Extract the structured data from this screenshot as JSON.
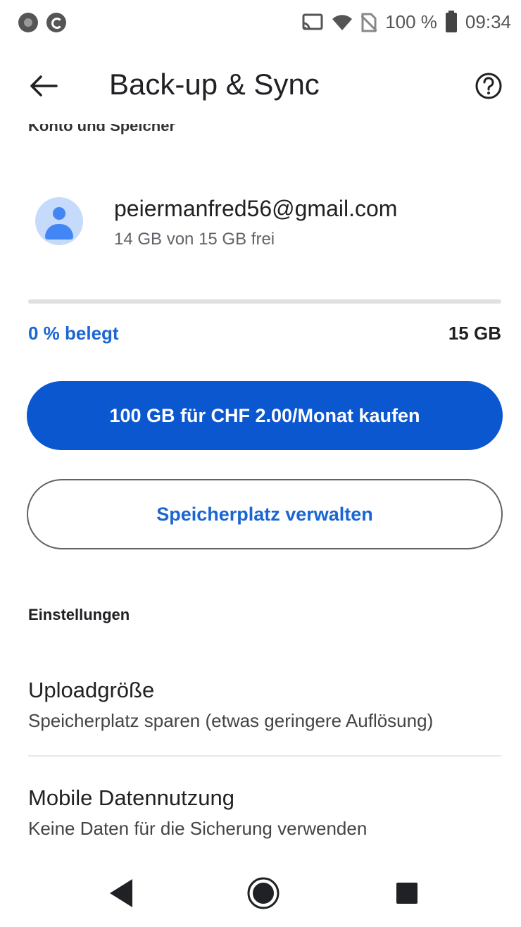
{
  "status_bar": {
    "battery": "100 %",
    "time": "09:34"
  },
  "app_bar": {
    "title": "Back-up & Sync"
  },
  "section_peek": "Konto und Speicher",
  "account": {
    "email": "peiermanfred56@gmail.com",
    "storage_free": "14 GB von 15 GB frei"
  },
  "storage": {
    "used_fraction": 0.0,
    "used_label": "0 % belegt",
    "total_label": "15 GB"
  },
  "buttons": {
    "buy": "100 GB für CHF 2.00/Monat kaufen",
    "manage": "Speicherplatz verwalten"
  },
  "settings": {
    "header": "Einstellungen",
    "items": [
      {
        "title": "Uploadgröße",
        "subtitle": "Speicherplatz sparen (etwas geringere Auflösung)"
      },
      {
        "title": "Mobile Datennutzung",
        "subtitle": "Keine Daten für die Sicherung verwenden"
      }
    ]
  },
  "colors": {
    "accent": "#0b57d0",
    "link": "#1a66d2"
  },
  "icons": [
    "back-arrow-icon",
    "help-icon",
    "avatar-icon",
    "cast-icon",
    "wifi-icon",
    "no-sim-icon",
    "battery-icon",
    "nav-back-icon",
    "nav-home-icon",
    "nav-recents-icon"
  ]
}
